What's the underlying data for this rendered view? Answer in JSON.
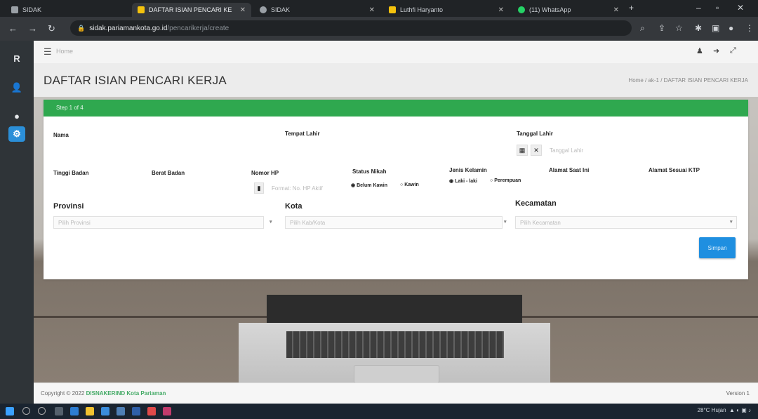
{
  "browser": {
    "tabs": [
      {
        "label": "SIDAK",
        "active": false,
        "favicon_color": "#9aa0a6"
      },
      {
        "label": "DAFTAR ISIAN PENCARI KE",
        "active": true,
        "favicon_color": "#f4c20d"
      },
      {
        "label": "SIDAK",
        "active": false,
        "favicon_color": "#9aa0a6"
      },
      {
        "label": "Luthfi Haryanto",
        "active": false,
        "favicon_color": "#f4c20d"
      },
      {
        "label": "(11) WhatsApp",
        "active": false,
        "favicon_color": "#25d366"
      }
    ],
    "url_domain": "sidak.pariamankota.go.id",
    "url_path": "/pencarikerja/create"
  },
  "app": {
    "rail_items": [
      "R",
      "👤",
      "●",
      "⚙"
    ],
    "topnav_crumb": "Home",
    "page_title": "DAFTAR ISIAN PENCARI KERJA",
    "breadcrumb": "Home / ak-1 / DAFTAR ISIAN PENCARI KERJA",
    "step_label": "Step 1 of 4",
    "fields": {
      "nama": "Nama",
      "tempat_lahir": "Tempat Lahir",
      "tanggal_lahir": "Tanggal Lahir",
      "tanggal_lahir_placeholder": "Tanggal Lahir",
      "tinggi_badan": "Tinggi Badan",
      "berat_badan": "Berat Badan",
      "nomor_hp": "Nomor HP",
      "nomor_hp_placeholder": "Format: No. HP Aktif",
      "status_nikah": "Status Nikah",
      "status_opt_1": "Belum Kawin",
      "status_opt_2": "Kawin",
      "jenis_kelamin": "Jenis Kelamin",
      "jk_opt_1": "Laki - laki",
      "jk_opt_2": "Perempuan",
      "alamat_saat_ini": "Alamat Saat Ini",
      "alamat_sesuai_ktp": "Alamat Sesuai KTP",
      "provinsi": "Provinsi",
      "provinsi_placeholder": "Pilih Provinsi",
      "kota": "Kota",
      "kota_placeholder": "Pilih Kab/Kota",
      "kecamatan": "Kecamatan",
      "kecamatan_placeholder": "Pilih Kecamatan"
    },
    "next_button": "Simpan",
    "footer_copyright_prefix": "Copyright © 2022",
    "footer_copyright_org": "DISNAKERIND Kota Pariaman",
    "footer_version": "Version 1"
  },
  "taskbar": {
    "tray_text": "28°C Hujan"
  },
  "colors": {
    "accent_green": "#2fa84f",
    "accent_blue": "#1f8fe0"
  }
}
